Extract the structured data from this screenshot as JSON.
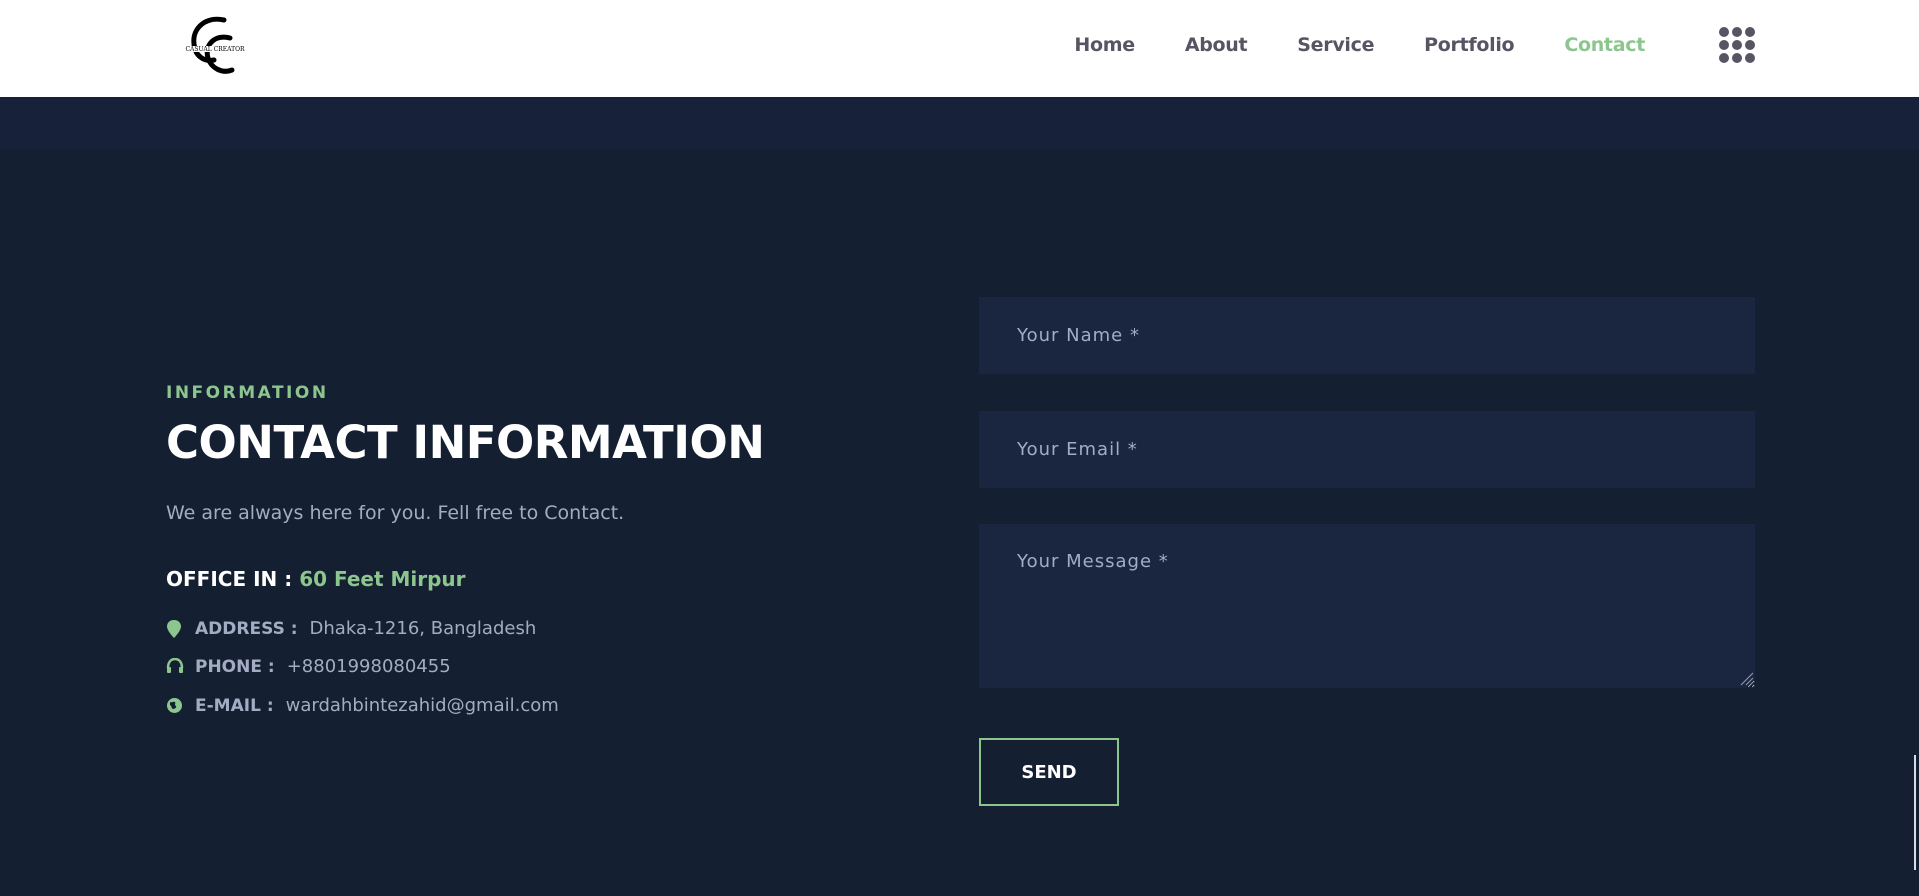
{
  "header": {
    "logo_text": "CASUAL CREATOR",
    "nav": [
      {
        "label": "Home",
        "active": false
      },
      {
        "label": "About",
        "active": false
      },
      {
        "label": "Service",
        "active": false
      },
      {
        "label": "Portfolio",
        "active": false
      },
      {
        "label": "Contact",
        "active": true
      }
    ],
    "menu_icon": "grid-menu-icon"
  },
  "info": {
    "eyebrow": "INFORMATION",
    "title": "CONTACT INFORMATION",
    "description": "We are always here for you. Fell free to Contact.",
    "office_label": "OFFICE IN :",
    "office_location": "60 Feet Mirpur",
    "rows": [
      {
        "icon": "map-pin-icon",
        "label": "ADDRESS :",
        "value": "Dhaka-1216, Bangladesh"
      },
      {
        "icon": "headphones-icon",
        "label": "PHONE :",
        "value": "+8801998080455"
      },
      {
        "icon": "globe-icon",
        "label": "E-MAIL :",
        "value": "wardahbintezahid@gmail.com"
      }
    ]
  },
  "form": {
    "name_placeholder": "Your Name *",
    "email_placeholder": "Your Email *",
    "message_placeholder": "Your Message *",
    "send_label": "SEND"
  },
  "colors": {
    "accent": "#8cc68e",
    "background": "#141f32",
    "field_bg": "#1a2640",
    "nav_text": "#575464"
  }
}
